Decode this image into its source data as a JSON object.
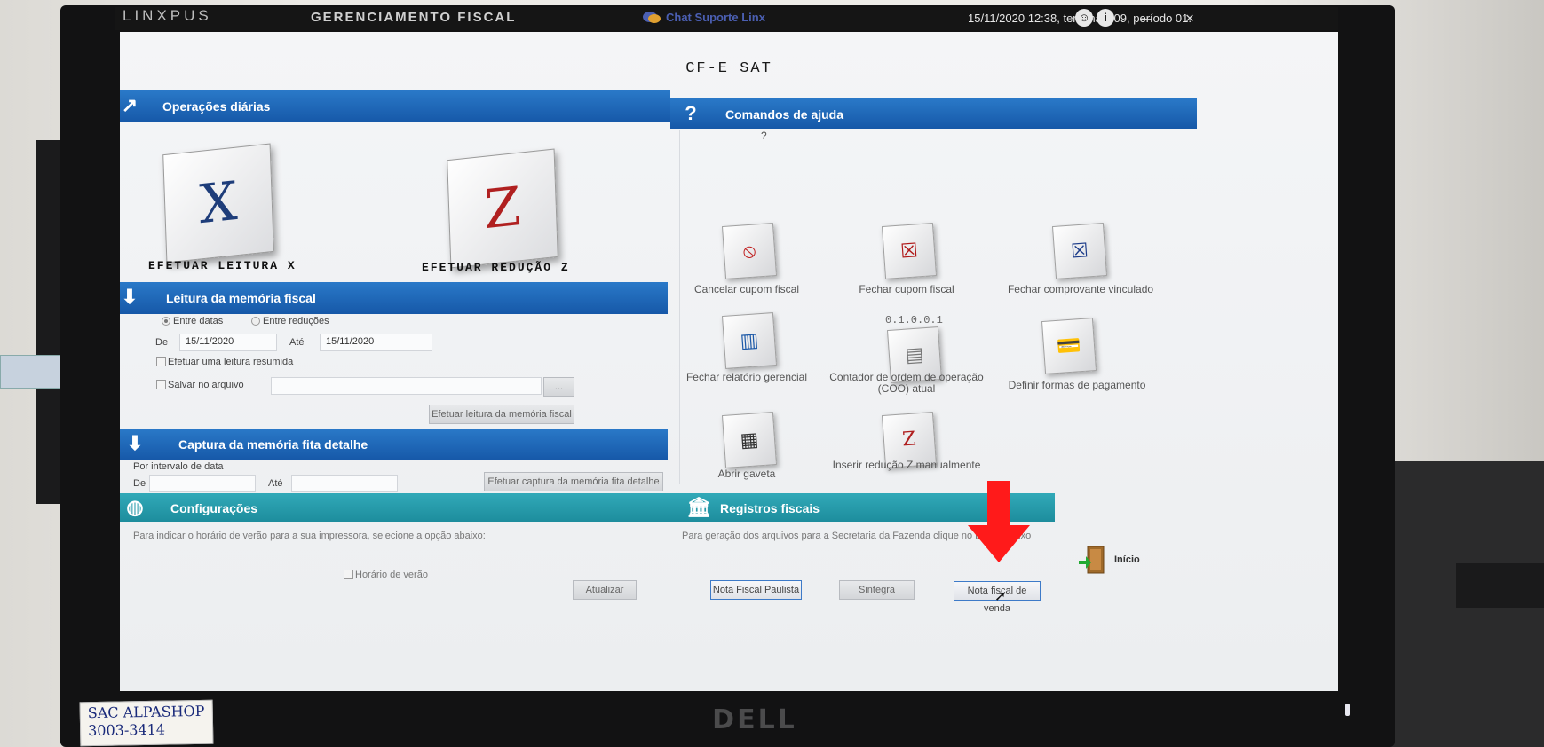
{
  "titlebar": {
    "logo": "LINXPUS",
    "title": "GERENCIAMENTO FISCAL",
    "chat": "Chat Suporte Linx",
    "info": "15/11/2020 12:38, terminal 009, período 01.",
    "minimize": "—",
    "close": "✕"
  },
  "screen": {
    "title": "CF-E SAT"
  },
  "daily_ops": {
    "header": "Operações diárias",
    "leitura_x_label": "EFETUAR LEITURA X",
    "leitura_x_letter": "X",
    "reducao_z_label": "EFETUAR REDUÇÃO Z",
    "reducao_z_letter": "Z"
  },
  "memory_read": {
    "header": "Leitura da memória fiscal",
    "radio_dates": "Entre datas",
    "radio_reductions": "Entre reduções",
    "from_label": "De",
    "from_value": "15/11/2020",
    "to_label": "Até",
    "to_value": "15/11/2020",
    "summary_check": "Efetuar uma leitura resumida",
    "save_check": "Salvar no arquivo",
    "browse": "...",
    "run_button": "Efetuar leitura da memória fiscal"
  },
  "capture": {
    "header": "Captura da memória fita detalhe",
    "interval_label": "Por intervalo de data",
    "from_label": "De",
    "to_label": "Até",
    "run_button": "Efetuar captura da memória fita detalhe"
  },
  "help": {
    "header": "Comandos de ajuda",
    "commands": [
      "Cancelar cupom fiscal",
      "Fechar cupom fiscal",
      "Fechar comprovante vinculado",
      "Fechar relatório gerencial",
      "Contador de ordem de operação (COO) atual",
      "Definir formas de pagamento",
      "Abrir gaveta",
      "Inserir redução Z manualmente"
    ],
    "coo_counter": "0.1.0.0.1"
  },
  "config": {
    "header": "Configurações",
    "description": "Para indicar o horário de verão para a sua impressora, selecione a opção abaixo:",
    "dst_check": "Horário de verão",
    "update_button": "Atualizar"
  },
  "registers": {
    "header": "Registros fiscais",
    "description": "Para geração dos arquivos para a Secretaria da Fazenda clique no botão abaixo",
    "nfp_button": "Nota Fiscal Paulista",
    "sintegra_button": "Sintegra",
    "nf_sale_button": "Nota fiscal de venda",
    "home_label": "Início"
  },
  "desk": {
    "sticky_line1": "SAC ALPASHOP",
    "sticky_line2": "3003-3414",
    "brand": "DELL"
  },
  "colors": {
    "band_blue": "#1d66b8",
    "band_teal": "#2499a9",
    "arrow_red": "#ff1a1a"
  }
}
